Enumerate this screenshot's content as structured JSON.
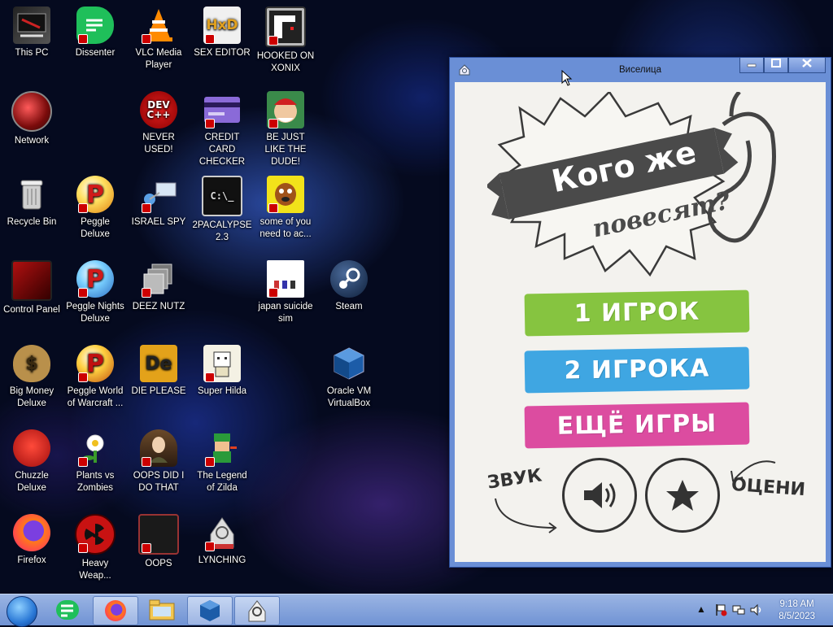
{
  "desktop": {
    "icons": [
      {
        "label": "This PC"
      },
      {
        "label": "Dissenter"
      },
      {
        "label": "VLC Media Player"
      },
      {
        "label": "SEX EDITOR"
      },
      {
        "label": "HOOKED ON XONIX"
      },
      {
        "label": "Network"
      },
      {
        "label": "NEVER USED!"
      },
      {
        "label": "CREDIT CARD CHECKER"
      },
      {
        "label": "BE JUST LIKE THE DUDE!"
      },
      {
        "label": "Recycle Bin"
      },
      {
        "label": "Peggle Deluxe"
      },
      {
        "label": "ISRAEL SPY"
      },
      {
        "label": "2PACALYPSE 2.3"
      },
      {
        "label": "some of you need to ac..."
      },
      {
        "label": "Control Panel"
      },
      {
        "label": "Peggle Nights Deluxe"
      },
      {
        "label": "DEEZ NUTZ"
      },
      {
        "label": "japan suicide sim"
      },
      {
        "label": "Steam"
      },
      {
        "label": "Big Money Deluxe"
      },
      {
        "label": "Peggle World of Warcraft ..."
      },
      {
        "label": "DIE PLEASE"
      },
      {
        "label": "Super Hilda"
      },
      {
        "label": "Oracle VM VirtualBox"
      },
      {
        "label": "Chuzzle Deluxe"
      },
      {
        "label": "Plants vs Zombies"
      },
      {
        "label": "OOPS DID I DO THAT"
      },
      {
        "label": "The Legend of Zilda"
      },
      {
        "label": "Firefox"
      },
      {
        "label": "Heavy Weap..."
      },
      {
        "label": "OOPS"
      },
      {
        "label": "LYNCHING"
      }
    ],
    "icon_glyphs": {
      "dev": "DEV\nC++",
      "de": "De",
      "cmd": "C:\\_"
    }
  },
  "window": {
    "title": "Виселица",
    "logo_line1": "Кого же",
    "logo_line2": "повесят?",
    "buttons": {
      "one_player": "1 ИГРОК",
      "two_players": "2 ИГРОКА",
      "more_games": "ЕЩЁ ИГРЫ"
    },
    "sound_label": "ЗВУК",
    "rate_label": "ОЦЕНИ",
    "colors": {
      "green": "#86c440",
      "blue": "#3fa6e2",
      "pink": "#dc4ca0",
      "banner": "#4a4a4a"
    }
  },
  "taskbar": {
    "time": "9:18 AM",
    "date": "8/5/2023"
  }
}
